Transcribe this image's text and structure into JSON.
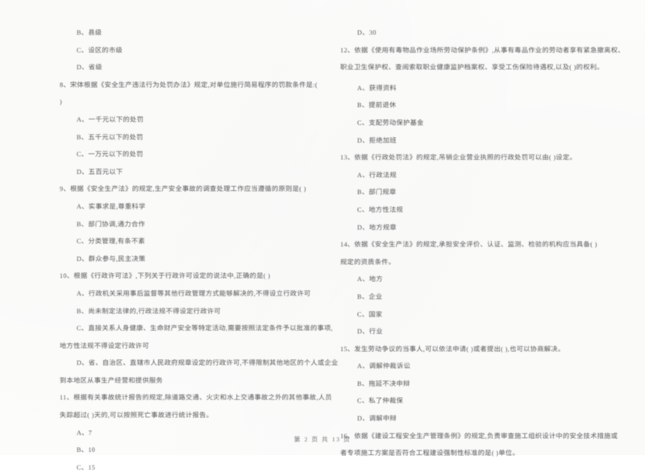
{
  "document": {
    "type": "scanned-exam-paper",
    "footer": "第 2 页 共 13 页"
  },
  "left_column": {
    "orphan_options": [
      "B、县级",
      "C、设区的市级",
      "D、省级"
    ],
    "questions": [
      {
        "number": "8",
        "stem_lines": [
          "8、宋体根据《安全生产违法行为处罚办法》规定,对单位施行简易程序的罚款条件是:(",
          ")"
        ],
        "options": [
          "A、一千元以下的处罚",
          "B、五千元以下的处罚",
          "C、一万元以下的处罚",
          "D、五百元以下"
        ]
      },
      {
        "number": "9",
        "stem_lines": [
          "9、根据《安全生产法》的规定,生产安全事故的调查处理工作应当遵循的原则是(        )"
        ],
        "options": [
          "A、实事求是,尊重科学",
          "B、部门协调,通力合作",
          "C、分类管理,有条不紊",
          "D、群众参与,民主决策"
        ]
      },
      {
        "number": "10",
        "stem_lines": [
          "10、根据《行政许可法》,下列关于行政许可设定的说法中,正确的是(        )"
        ],
        "options": [
          "A、行政机关采用事后监督等其他行政管理方式能够解决的,不得设立行政许可",
          "B、尚未制定法律的,行政法规不得设定行政许可",
          "C、直接关系人身健康、生命财产安全等特定活动,需要按照法定条件予以批准的事项,",
          "D、省、自治区、直辖市人民政府规章设定的行政许可,不得限制其他地区的个人或企业"
        ],
        "continuations": [
          "地方性法规不得设定行政许可",
          "到本地区从事生产经营和提供服务"
        ]
      },
      {
        "number": "11",
        "stem_lines": [
          "11、根据有关事故统计报告的规定,除道路交通、火灾和水上交通事故之外的其他事故,人员",
          "失踪超过(      )天的,可以按照死亡事故进行统计报告。"
        ],
        "options": [
          "A、7",
          "B、10",
          "C、15"
        ]
      }
    ]
  },
  "right_column": {
    "orphan_options": [
      "D、30"
    ],
    "questions": [
      {
        "number": "12",
        "stem_lines": [
          "12、依据《使用有毒物品作业场所劳动保护条例》,从事有毒品作业的劳动者享有紧急撤离权、",
          "职业卫生保护权、查阅索取职业健康监护档案权、享受工伤保险待遇权,以及(      )的权利。"
        ],
        "options": [
          "A、获得资料",
          "B、提前退休",
          "C、支配劳动保护基金",
          "D、拒绝加班"
        ]
      },
      {
        "number": "13",
        "stem_lines": [
          "13、依据《行政处罚法》的规定,吊销企业营业执照的行政处罚可以由(      )设定。"
        ],
        "options": [
          "A、行政法规",
          "B、部门规章",
          "C、地方性法规",
          "D、地方规章"
        ]
      },
      {
        "number": "14",
        "stem_lines": [
          "14、依据《安全生产法》的规定,承担安全评价、认证、监测、检验的机构应当具备(        )",
          "规定的资质条件。"
        ],
        "options": [
          "A、地方",
          "B、企业",
          "C、国家",
          "D、行业"
        ]
      },
      {
        "number": "15",
        "stem_lines": [
          "15、发生劳动争议的当事人,可以依法申请(      )或者提出(      ),也可以协商解决。"
        ],
        "options": [
          "A、调解仲裁诉讼",
          "B、拖延不决申辩",
          "C、私了仲裁保",
          "D、调解申辩"
        ]
      },
      {
        "number": "16",
        "stem_lines": [
          "16、依据《建设工程安全生产管理条例》的规定,负责审查施工组织设计中的安全技术措施或",
          "者专项施工方案是否符合工程建设强制性标准的是(      )单位。"
        ],
        "options": []
      }
    ]
  }
}
